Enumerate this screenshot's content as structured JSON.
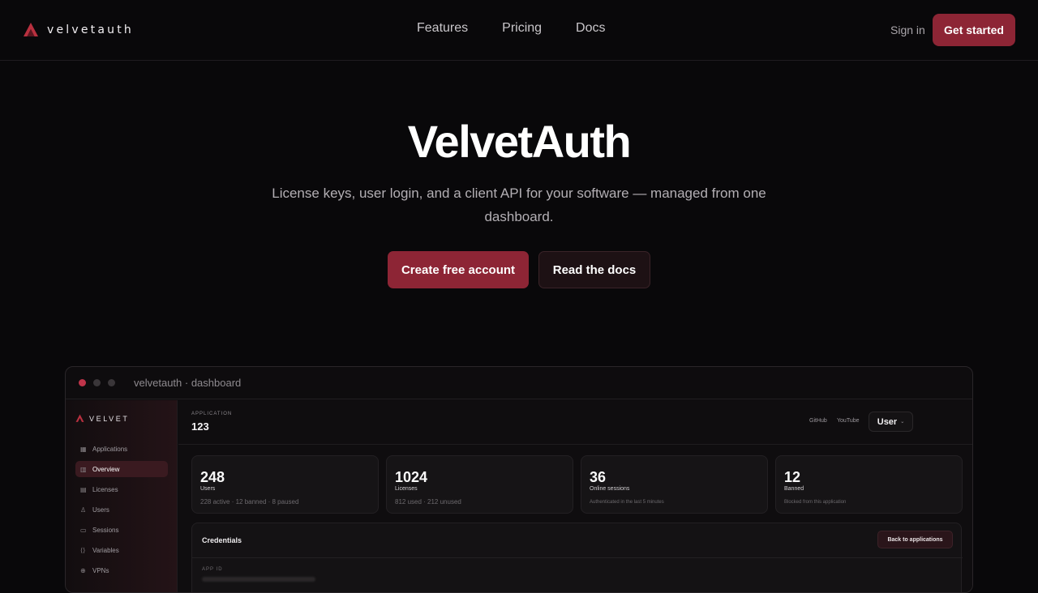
{
  "nav": {
    "brand": "velvetauth",
    "links": [
      "Features",
      "Pricing",
      "Docs"
    ],
    "signin": "Sign in",
    "cta": "Get started"
  },
  "hero": {
    "title": "VelvetAuth",
    "subtitle": "License keys, user login, and a client API for your software — managed from one dashboard.",
    "primary": "Create free account",
    "secondary": "Read the docs"
  },
  "preview": {
    "window_title": "velvetauth · dashboard",
    "dots": [
      "#c0344a",
      "#3a3639",
      "#3a3639"
    ],
    "sidebar": {
      "brand": "VELVET",
      "items": [
        {
          "icon": "▦",
          "label": "Applications"
        },
        {
          "icon": "▥",
          "label": "Overview"
        },
        {
          "icon": "▤",
          "label": "Licenses"
        },
        {
          "icon": "♙",
          "label": "Users"
        },
        {
          "icon": "▭",
          "label": "Sessions"
        },
        {
          "icon": "⟨⟩",
          "label": "Variables"
        },
        {
          "icon": "⊕",
          "label": "VPNs"
        }
      ],
      "active": "Overview"
    },
    "header": {
      "app_label": "APPLICATION",
      "app_name": "123",
      "github": "GitHub",
      "youtube": "YouTube",
      "user": "User"
    },
    "stats": [
      {
        "value": "248",
        "label": "Users",
        "sub": "228 active · 12 banned · 8 paused"
      },
      {
        "value": "1024",
        "label": "Licenses",
        "sub": "812 used · 212 unused"
      },
      {
        "value": "36",
        "label": "Online sessions",
        "sub": "Authenticated in the last 5 minutes"
      },
      {
        "value": "12",
        "label": "Banned",
        "sub": "Blocked from this application"
      }
    ],
    "credentials": {
      "title": "Credentials",
      "back": "Back to applications",
      "field_label": "APP ID"
    }
  },
  "colors": {
    "accent": "#8d2535",
    "background": "#09080a"
  }
}
